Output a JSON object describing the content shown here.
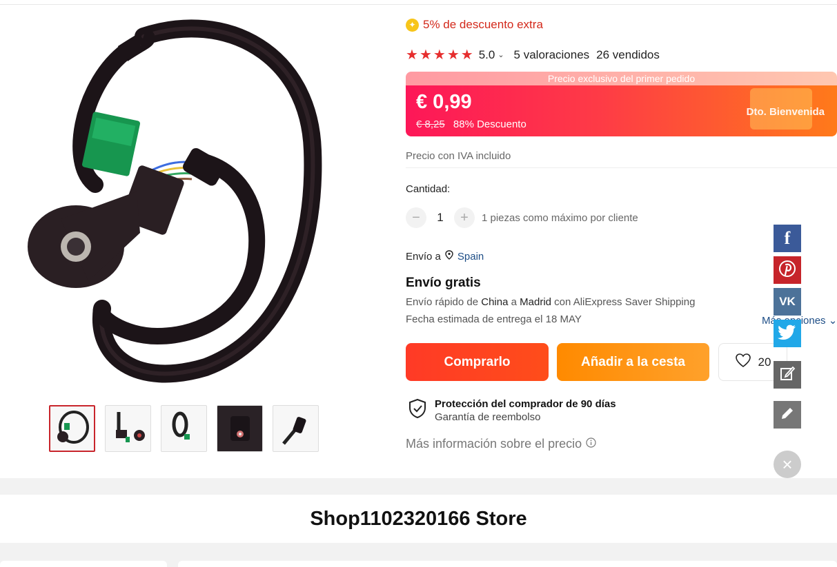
{
  "coupon": {
    "text": "5% de descuento extra",
    "icon": "star-coin-icon"
  },
  "rating": {
    "stars": 5,
    "score": "5.0",
    "reviews": "5 valoraciones",
    "sold": "26 vendidos"
  },
  "price": {
    "banner_label": "Precio exclusivo del primer pedido",
    "current": "€ 0,99",
    "original": "€ 8,25",
    "discount": "88% Descuento",
    "welcome": "Dto. Bienvenida"
  },
  "tax_note": "Precio con IVA incluido",
  "quantity": {
    "label": "Cantidad:",
    "value": "1",
    "limit": "1 piezas como máximo por cliente"
  },
  "shipping": {
    "to_label": "Envío a",
    "country": "Spain",
    "free": "Envío gratis",
    "line1_prefix": "Envío rápido de ",
    "line1_origin": "China",
    "line1_mid": " a ",
    "line1_dest": "Madrid",
    "line1_suffix": " con AliExpress Saver Shipping",
    "eta": "Fecha estimada de entrega el 18 MAY",
    "more_options": "Más opciones"
  },
  "actions": {
    "buy": "Comprarlo",
    "cart": "Añadir a la cesta",
    "wishlist_count": "20"
  },
  "protection": {
    "title": "Protección del comprador de 90 días",
    "subtitle": "Garantía de reembolso"
  },
  "price_info": "Más información sobre el precio",
  "share": {
    "facebook": "f",
    "vk": "VK"
  },
  "store": {
    "name": "Shop1102320166 Store"
  },
  "thumbnails": 5
}
